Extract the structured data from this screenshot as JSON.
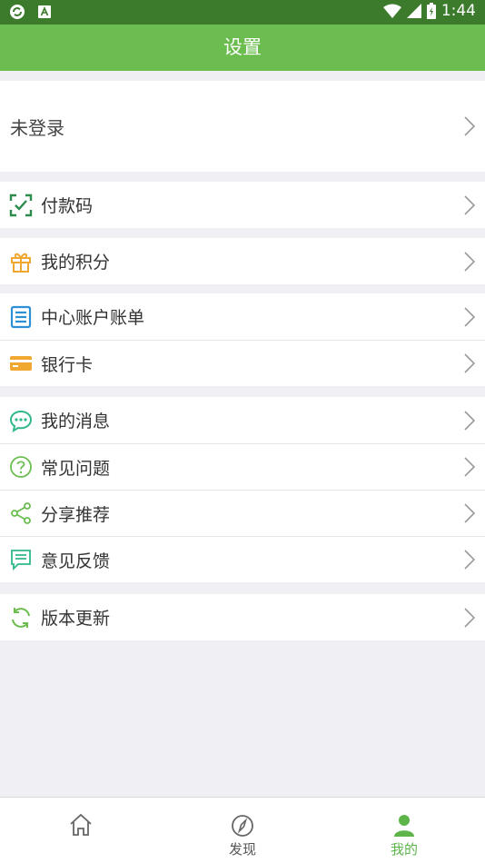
{
  "status_bar": {
    "time": "1:44"
  },
  "header": {
    "title": "设置"
  },
  "login": {
    "label": "未登录"
  },
  "menu": {
    "payment_code": "付款码",
    "my_points": "我的积分",
    "center_account_bill": "中心账户账单",
    "bank_card": "银行卡",
    "my_messages": "我的消息",
    "faq": "常见问题",
    "share_recommend": "分享推荐",
    "feedback": "意见反馈",
    "version_update": "版本更新"
  },
  "bottom_nav": {
    "items": [
      {
        "label": "",
        "icon": "home-icon"
      },
      {
        "label": "发现",
        "icon": "compass-icon"
      },
      {
        "label": "我的",
        "icon": "user-icon",
        "active": true
      }
    ]
  },
  "colors": {
    "header_bg": "#6bbd4f",
    "status_bg": "#3c7a2c",
    "active_tab": "#5db54a",
    "page_bg": "#f0eff4"
  }
}
